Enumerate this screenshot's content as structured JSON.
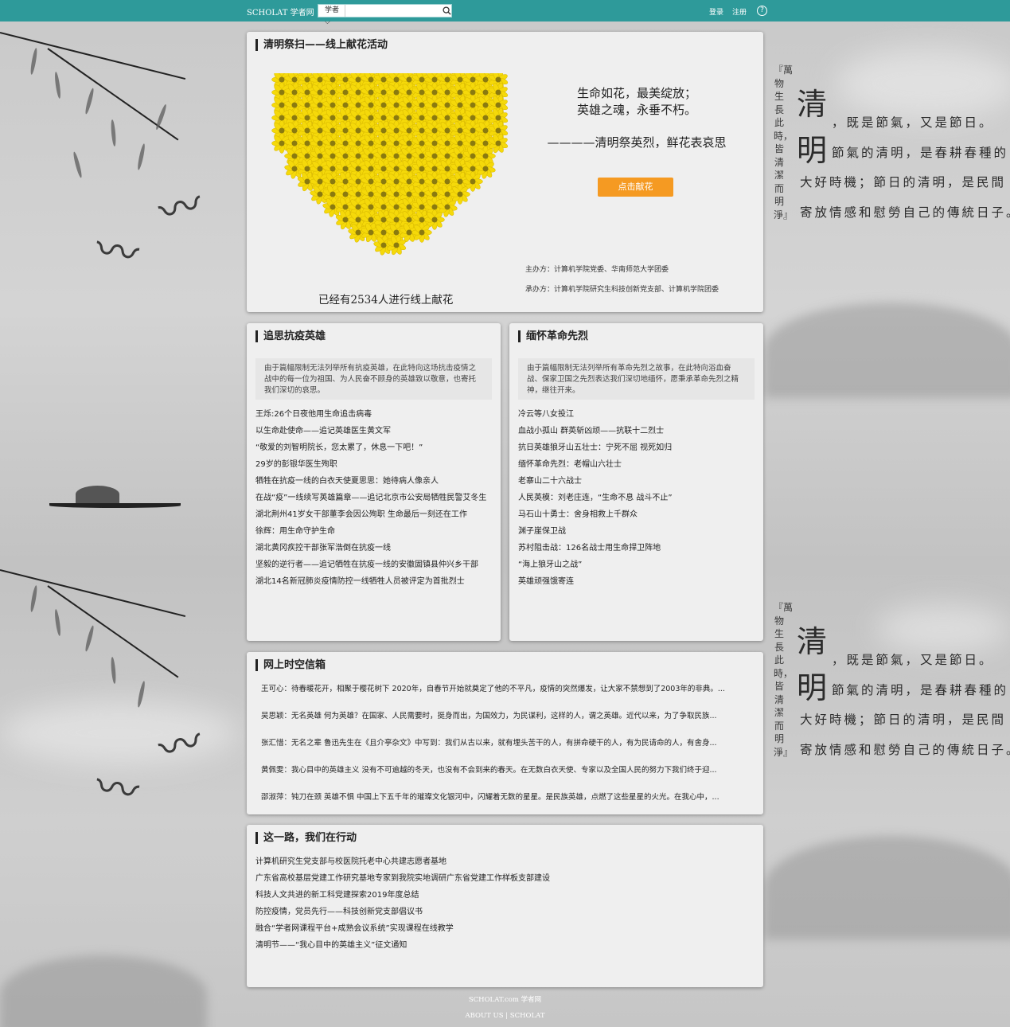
{
  "topbar": {
    "brand": "SCHOLAT 学者网",
    "search_select": "学者",
    "search_placeholder": "",
    "login": "登录",
    "register": "注册",
    "help": "?"
  },
  "hero": {
    "title": "清明祭扫——线上献花活动",
    "motto_line1": "生命如花，最美绽放；",
    "motto_line2": "英雄之魂，永垂不朽。",
    "motto_line3": "————清明祭英烈，鲜花表哀思",
    "button": "点击献花",
    "host": "主办方：计算机学院党委、华南师范大学团委",
    "organizer": "承办方：计算机学院研究生科技创新党支部、计算机学院团委",
    "count": "已经有2534人进行线上献花"
  },
  "heroes": {
    "title": "追思抗疫英雄",
    "intro": "由于篇幅限制无法列举所有抗疫英雄，在此特向这场抗击疫情之战中的每一位为祖国、为人民奋不顾身的英雄致以敬意，也寄托我们深切的哀思。",
    "items": [
      "王烁:26个日夜他用生命追击病毒",
      "以生命赴使命——追记英雄医生黄文军",
      "“敬爱的刘智明院长，您太累了，休息一下吧！”",
      "29岁的彭银华医生殉职",
      "牺牲在抗疫一线的白衣天使夏思思：她待病人像亲人",
      "在战“疫”一线续写英雄篇章——追记北京市公安局牺牲民警艾冬生",
      "湖北荆州41岁女干部董李会因公殉职 生命最后一刻还在工作",
      "徐辉：用生命守护生命",
      "湖北黄冈疾控干部张军浩倒在抗疫一线",
      "坚毅的逆行者——追记牺牲在抗疫一线的安徽固镇县仲兴乡干部",
      "湖北14名新冠肺炎疫情防控一线牺牲人员被评定为首批烈士"
    ]
  },
  "martyrs": {
    "title": "缅怀革命先烈",
    "intro": "由于篇幅限制无法列举所有革命先烈之故事，在此特向浴血奋战、保家卫国之先烈表达我们深切地缅怀，愿秉承革命先烈之精神，继往开来。",
    "items": [
      "冷云等八女投江",
      "血战小孤山 群英斩凶顽——抗联十二烈士",
      "抗日英雄狼牙山五壮士：宁死不屈 视死如归",
      "缅怀革命先烈：老帽山六壮士",
      "老寨山二十六战士",
      "人民英模：刘老庄连，“生命不息 战斗不止”",
      "马石山十勇士：舍身相救上千群众",
      "渊子崖保卫战",
      "苏村阻击战：126名战士用生命捍卫阵地",
      "“海上狼牙山之战”",
      "英雄顽强饿寄连"
    ]
  },
  "letters": {
    "title": "网上时空信箱",
    "items": [
      "王可心：待春暖花开，相聚于樱花树下 2020年，自春节开始就奠定了他的不平凡，疫情的突然爆发，让大家不禁想到了2003年的非典。...",
      "吴思颖：无名英雄 何为英雄？在国家、人民需要时，挺身而出，为国效力，为民谋利，这样的人，谓之英雄。近代以来，为了争取民族...",
      "张汇惜：无名之辈 鲁迅先生在《且介亭杂文》中写到：我们从古以来，就有埋头苦干的人，有拼命硬干的人，有为民请命的人，有舍身...",
      "黄佩雯：我心目中的英雄主义 没有不可逾越的冬天，也没有不会到来的春天。在无数白衣天使、专家以及全国人民的努力下我们终于迎...",
      "邵淑萍：钝刀在颈 英雄不惧 中国上下五千年的璀璨文化银河中，闪耀着无数的星星。是民族英雄，点燃了这些星星的火光。在我心中，..."
    ]
  },
  "actions": {
    "title": "这一路，我们在行动",
    "items": [
      "计算机研究生党支部与校医院托老中心共建志愿者基地",
      "广东省高校基层党建工作研究基地专家到我院实地调研广东省党建工作样板支部建设",
      "科技人文共进的新工科党建探索2019年度总结",
      "防控疫情，党员先行——科技创新党支部倡议书",
      "融合“学者网课程平台+成熟会议系统”实现课程在线教学",
      "清明节——“我心目中的英雄主义”征文通知"
    ]
  },
  "calligraphy": {
    "vertical": "『萬物生長此時，皆清潔而明淨』",
    "big1": "清",
    "big2": "明",
    "line1": "，既是節氣，又是節日。",
    "line2": "節氣的清明，是春耕春種的",
    "line3": "大好時機；節日的清明，是民間",
    "line4": "寄放情感和慰勞自己的傳統日子。"
  },
  "footer": {
    "line1": "SCHOLAT.com 学者网",
    "line2": "ABOUT US | SCHOLAT"
  },
  "colors": {
    "topbar": "#2e9a9a",
    "button": "#f59a22",
    "flower": "#f5d90a"
  }
}
